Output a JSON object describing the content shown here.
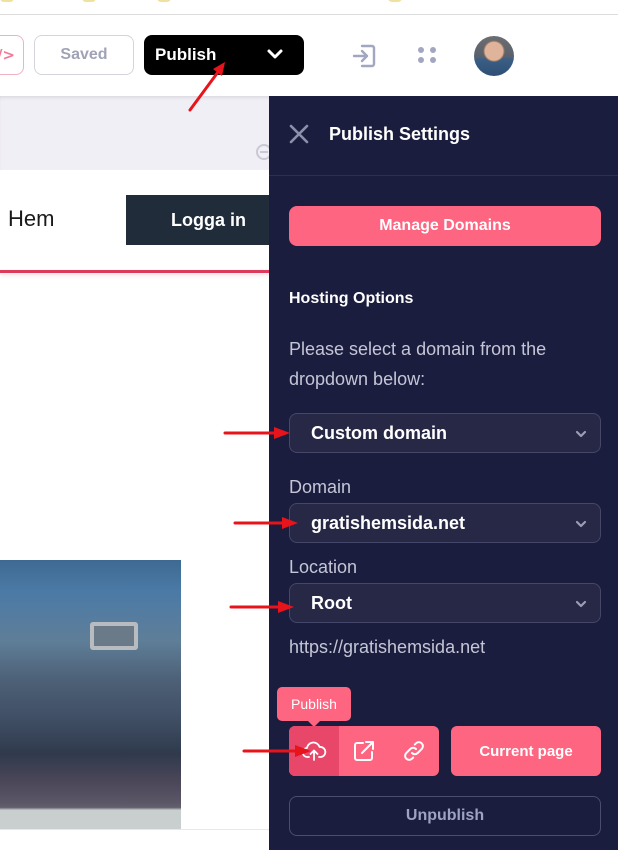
{
  "toolbar": {
    "code_icon_glyph": "/>",
    "saved_label": "Saved",
    "publish_label": "Publish"
  },
  "site": {
    "nav_home": "Hem",
    "nav_login": "Logga in"
  },
  "panel": {
    "title": "Publish Settings",
    "manage_domains_label": "Manage Domains",
    "hosting_title": "Hosting Options",
    "hosting_desc": "Please select a domain from the dropdown below:",
    "hosting_select_value": "Custom domain",
    "domain_label": "Domain",
    "domain_select_value": "gratishemsida.net",
    "location_label": "Location",
    "location_select_value": "Root",
    "url": "https://gratishemsida.net",
    "tooltip": "Publish",
    "current_page_label": "Current page",
    "unpublish_label": "Unpublish"
  },
  "colors": {
    "panel_bg": "#1b1d3e",
    "accent": "#fd6581",
    "accent_active": "#e8476a",
    "publish_btn_bg": "#000000",
    "site_nav_accent": "#dc3b5b",
    "login_btn_bg": "#202c3a",
    "annotation_arrow": "#e8141c"
  },
  "icons": {
    "code": "code-icon",
    "chevron": "chevron-down-icon",
    "login": "sign-in-icon",
    "apps": "dots-grid-icon",
    "avatar": "user-avatar",
    "close": "close-icon",
    "publish": "cloud-upload-icon",
    "open": "external-link-icon",
    "link": "link-icon",
    "zoom_out": "zoom-out-icon"
  }
}
